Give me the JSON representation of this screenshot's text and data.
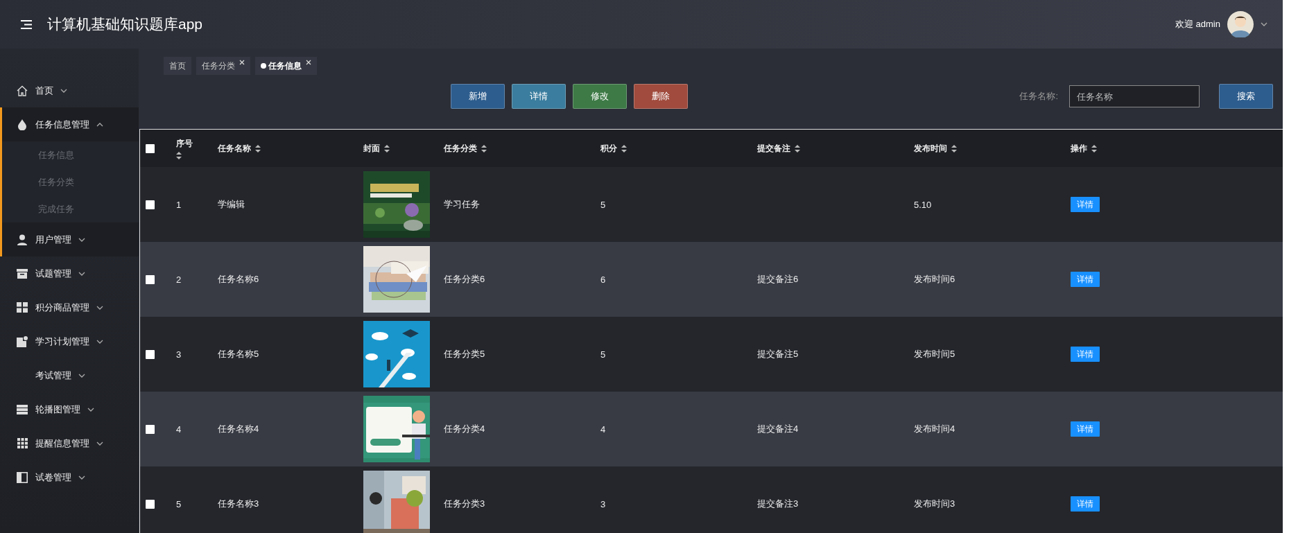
{
  "header": {
    "title": "计算机基础知识题库app",
    "welcome": "欢迎 admin"
  },
  "sidebar": {
    "items": [
      {
        "label": "首页",
        "expanded": false,
        "active": false
      },
      {
        "label": "任务信息管理",
        "expanded": true,
        "active": true,
        "children": [
          {
            "label": "任务信息"
          },
          {
            "label": "任务分类"
          },
          {
            "label": "完成任务"
          }
        ]
      },
      {
        "label": "用户管理",
        "expanded": false,
        "active": true
      },
      {
        "label": "试题管理",
        "expanded": false,
        "active": false
      },
      {
        "label": "积分商品管理",
        "expanded": false,
        "active": false
      },
      {
        "label": "学习计划管理",
        "expanded": false,
        "active": false
      },
      {
        "label": "考试管理",
        "expanded": false,
        "active": false
      },
      {
        "label": "轮播图管理",
        "expanded": false,
        "active": false
      },
      {
        "label": "提醒信息管理",
        "expanded": false,
        "active": false
      },
      {
        "label": "试卷管理",
        "expanded": false,
        "active": false
      }
    ]
  },
  "tabs": [
    {
      "label": "首页",
      "selected": false,
      "closable": false
    },
    {
      "label": "任务分类",
      "selected": false,
      "closable": true
    },
    {
      "label": "任务信息",
      "selected": true,
      "closable": true
    }
  ],
  "toolbar": {
    "buttons": [
      {
        "label": "新增",
        "kind": "add"
      },
      {
        "label": "详情",
        "kind": "detail"
      },
      {
        "label": "修改",
        "kind": "edit"
      },
      {
        "label": "删除",
        "kind": "delete"
      }
    ],
    "search": {
      "label": "任务名称:",
      "placeholder": "任务名称",
      "button": "搜索"
    }
  },
  "table": {
    "all_checked": false,
    "columns": [
      "序号",
      "任务名称",
      "封面",
      "任务分类",
      "积分",
      "提交备注",
      "发布时间",
      "操作"
    ],
    "rows": [
      {
        "checked": false,
        "index": "1",
        "name": "学编辑",
        "category": "学习任务",
        "points": "5",
        "note": "",
        "time": "5.10",
        "action": "详情"
      },
      {
        "checked": false,
        "index": "2",
        "name": "任务名称6",
        "category": "任务分类6",
        "points": "6",
        "note": "提交备注6",
        "time": "发布时间6",
        "action": "详情"
      },
      {
        "checked": false,
        "index": "3",
        "name": "任务名称5",
        "category": "任务分类5",
        "points": "5",
        "note": "提交备注5",
        "time": "发布时间5",
        "action": "详情"
      },
      {
        "checked": false,
        "index": "4",
        "name": "任务名称4",
        "category": "任务分类4",
        "points": "4",
        "note": "提交备注4",
        "time": "发布时间4",
        "action": "详情"
      },
      {
        "checked": false,
        "index": "5",
        "name": "任务名称3",
        "category": "任务分类3",
        "points": "3",
        "note": "提交备注3",
        "time": "发布时间3",
        "action": "详情"
      }
    ]
  }
}
